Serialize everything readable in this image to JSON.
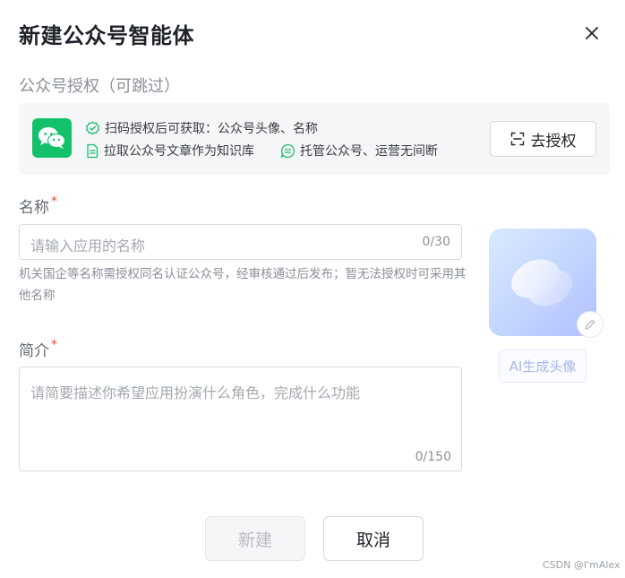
{
  "dialog": {
    "title": "新建公众号智能体",
    "close_icon": "close-icon"
  },
  "authorization": {
    "section_label": "公众号授权（可跳过）",
    "logo_icon": "wechat-logo-icon",
    "features": [
      {
        "icon": "check-shield-icon",
        "text": "扫码授权后可获取：公众号头像、名称"
      },
      {
        "icon": "document-icon",
        "text": "拉取公众号文章作为知识库"
      },
      {
        "icon": "chat-bubble-icon",
        "text": "托管公众号、运营无间断"
      }
    ],
    "button_icon": "scan-icon",
    "button_label": "去授权"
  },
  "name_field": {
    "label": "名称",
    "required_mark": "*",
    "placeholder": "请输入应用的名称",
    "counter": "0/30",
    "hint": "机关国企等名称需授权同名认证公众号，经审核通过后发布；暂无法授权时可采用其他名称"
  },
  "intro_field": {
    "label": "简介",
    "required_mark": "*",
    "placeholder": "请简要描述你希望应用扮演什么角色，完成什么功能",
    "counter": "0/150"
  },
  "avatar": {
    "edit_icon": "pencil-icon",
    "ai_button_label": "AI生成头像"
  },
  "footer": {
    "create_label": "新建",
    "cancel_label": "取消"
  },
  "watermark": "CSDN @I'mAlex",
  "colors": {
    "wechat_green": "#14c16b",
    "required_red": "#e94a4a",
    "feature_icon_green": "#1dbb73",
    "ai_button_text": "#a7b6ef"
  }
}
